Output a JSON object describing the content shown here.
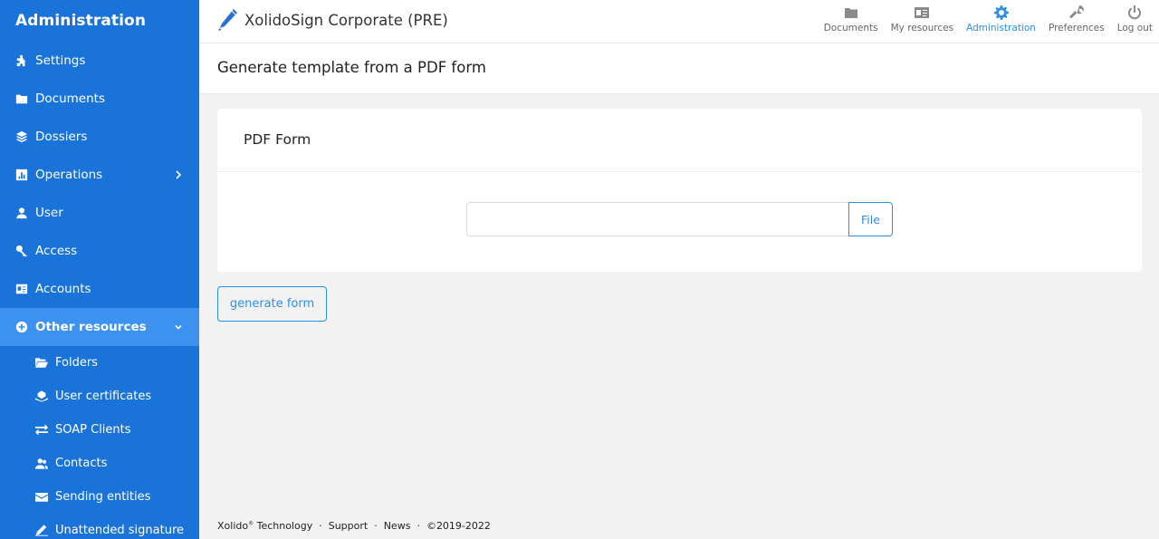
{
  "sidebar": {
    "title": "Administration",
    "items": [
      {
        "label": "Settings",
        "icon": "puzzle-icon"
      },
      {
        "label": "Documents",
        "icon": "folder-icon"
      },
      {
        "label": "Dossiers",
        "icon": "layers-icon"
      },
      {
        "label": "Operations",
        "icon": "chart-icon"
      },
      {
        "label": "User",
        "icon": "user-icon"
      },
      {
        "label": "Access",
        "icon": "key-icon"
      },
      {
        "label": "Accounts",
        "icon": "id-card-icon"
      },
      {
        "label": "Other resources",
        "icon": "plus-circle-icon"
      }
    ],
    "subitems": [
      {
        "label": "Folders",
        "icon": "folder-open-icon"
      },
      {
        "label": "User certificates",
        "icon": "hand-holding-icon"
      },
      {
        "label": "SOAP Clients",
        "icon": "exchange-icon"
      },
      {
        "label": "Contacts",
        "icon": "contacts-icon"
      },
      {
        "label": "Sending entities",
        "icon": "envelope-icon"
      },
      {
        "label": "Unattended signature",
        "icon": "pen-icon"
      }
    ]
  },
  "header": {
    "brand": "XolidoSign Corporate (PRE)",
    "nav": [
      {
        "label": "Documents",
        "icon": "folder-icon"
      },
      {
        "label": "My resources",
        "icon": "id-card-icon"
      },
      {
        "label": "Administration",
        "icon": "gear-icon"
      },
      {
        "label": "Preferences",
        "icon": "wrench-icon"
      },
      {
        "label": "Log out",
        "icon": "power-icon"
      }
    ]
  },
  "page": {
    "title": "Generate template from a PDF form",
    "card_title": "PDF Form",
    "file_input_value": "",
    "file_button": "File",
    "generate_button": "generate form"
  },
  "footer": {
    "brand": "Xolido",
    "reg": "®",
    "brand_suffix": " Technology",
    "support": "Support",
    "news": "News",
    "copyright": "©2019-2022"
  },
  "colors": {
    "sidebar_bg": "#1a73d9",
    "sidebar_active": "#3e92ef",
    "accent": "#2b8fe6",
    "page_bg": "#f2f2f2"
  }
}
